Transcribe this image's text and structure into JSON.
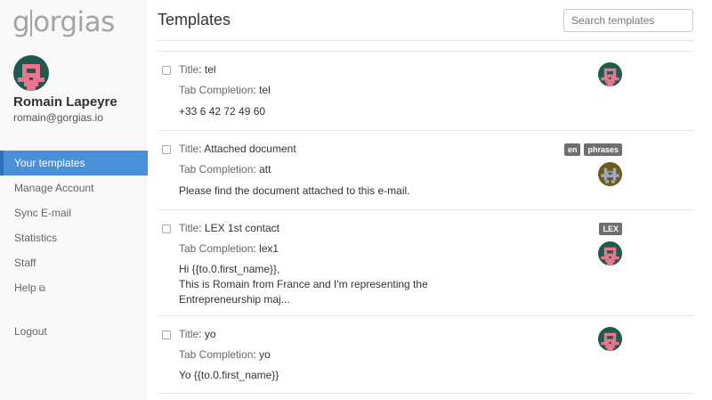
{
  "brand": {
    "logo_left": "g",
    "logo_right": "orgias"
  },
  "user": {
    "name": "Romain Lapeyre",
    "email": "romain@gorgias.io"
  },
  "nav": {
    "items": [
      {
        "label": "Your templates",
        "active": true
      },
      {
        "label": "Manage Account",
        "active": false
      },
      {
        "label": "Sync E-mail",
        "active": false
      },
      {
        "label": "Statistics",
        "active": false
      },
      {
        "label": "Staff",
        "active": false
      },
      {
        "label": "Help",
        "active": false
      }
    ],
    "logout": "Logout"
  },
  "header": {
    "title": "Templates",
    "search_placeholder": "Search templates"
  },
  "labels": {
    "title": "Title",
    "tab_completion": "Tab Completion"
  },
  "templates": [
    {
      "title": "tel",
      "tab_completion": "tel",
      "body": "+33 6 42 72 49 60",
      "tags": [],
      "avatar": "pink-avatar"
    },
    {
      "title": "Attached document",
      "tab_completion": "att",
      "body": "Please find the document attached to this e-mail.",
      "tags": [
        "en",
        "phrases"
      ],
      "avatar": "olive-avatar"
    },
    {
      "title": "LEX 1st contact",
      "tab_completion": "lex1",
      "body_lines": [
        "Hi {{to.0.first_name}},",
        "This is Romain from France and I'm representing the",
        "Entrepreneurship maj..."
      ],
      "tags": [
        "LEX"
      ],
      "avatar": "pink-avatar"
    },
    {
      "title": "yo",
      "tab_completion": "yo",
      "body": "Yo {{to.0.first_name}}",
      "tags": [],
      "avatar": "pink-avatar"
    }
  ],
  "colors": {
    "accent": "#4a90d9",
    "tag_bg": "#6f6f6f",
    "avatar_pink": "#e9758e",
    "avatar_teal": "#1f5a4f",
    "avatar_olive": "#6d5a1c"
  }
}
